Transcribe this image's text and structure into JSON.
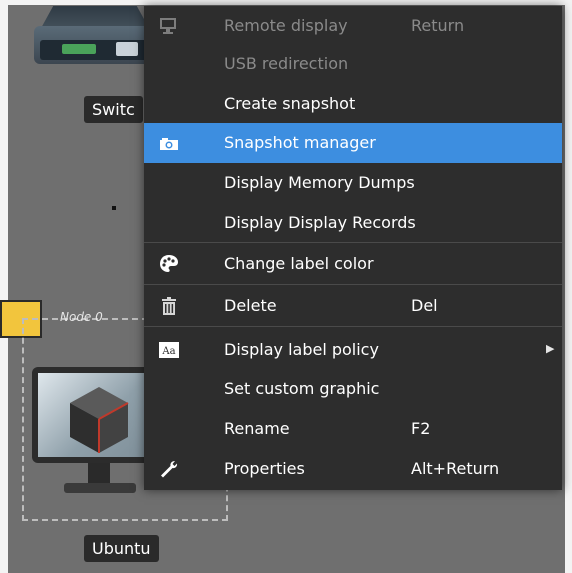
{
  "canvas": {
    "switch_label": "Switc",
    "node_group_label": "Node 0",
    "ubuntu_label": "Ubuntu"
  },
  "menu": {
    "items": [
      {
        "label": "Remote display",
        "shortcut": "Return",
        "disabled": true,
        "icon": "monitor-remote-icon"
      },
      {
        "label": "USB redirection",
        "shortcut": "",
        "disabled": true,
        "icon": ""
      },
      {
        "label": "Create snapshot",
        "shortcut": "",
        "disabled": false,
        "icon": ""
      },
      {
        "label": "Snapshot manager",
        "shortcut": "",
        "disabled": false,
        "active": true,
        "icon": "camera-icon"
      },
      {
        "label": "Display Memory Dumps",
        "shortcut": "",
        "disabled": false,
        "icon": ""
      },
      {
        "label": "Display Display Records",
        "shortcut": "",
        "disabled": false,
        "icon": ""
      },
      {
        "label": "Change label color",
        "shortcut": "",
        "disabled": false,
        "icon": "palette-icon"
      },
      {
        "label": "Delete",
        "shortcut": "Del",
        "disabled": false,
        "icon": "trash-icon"
      },
      {
        "label": "Display label policy",
        "shortcut": "",
        "disabled": false,
        "submenu": true,
        "icon": "font-icon"
      },
      {
        "label": "Set custom graphic",
        "shortcut": "",
        "disabled": false,
        "icon": ""
      },
      {
        "label": "Rename",
        "shortcut": "F2",
        "disabled": false,
        "icon": ""
      },
      {
        "label": "Properties",
        "shortcut": "Alt+Return",
        "disabled": false,
        "icon": "wrench-icon"
      }
    ],
    "icon_glyphs": {
      "font": "Aa"
    }
  },
  "colors": {
    "menu_bg": "#2d2d2d",
    "highlight": "#3d8ee0",
    "canvas_bg": "#6f6f6f",
    "node_yellow": "#f2c53d"
  }
}
